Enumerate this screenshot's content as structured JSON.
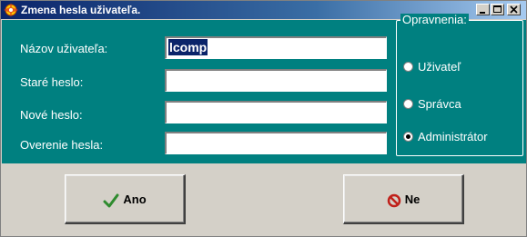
{
  "window": {
    "title": "Zmena hesla uživateľa.",
    "controls": {
      "minimize_icon": "minimize-icon",
      "maximize_icon": "maximize-icon",
      "close_icon": "close-icon"
    }
  },
  "form": {
    "fields": [
      {
        "label": "Názov uživateľa:",
        "value": "lcomp",
        "selected": true
      },
      {
        "label": "Staré heslo:",
        "value": ""
      },
      {
        "label": "Nové heslo:",
        "value": ""
      },
      {
        "label": "Overenie hesla:",
        "value": ""
      }
    ]
  },
  "permissions": {
    "title": "Opravnenia:",
    "options": [
      {
        "label": "Uživateľ",
        "checked": false
      },
      {
        "label": "Správca",
        "checked": false
      },
      {
        "label": "Administrátor",
        "checked": true
      }
    ]
  },
  "buttons": {
    "ok": {
      "label": "Ano",
      "icon": "checkmark-icon",
      "icon_color": "#2e8b2e"
    },
    "cancel": {
      "label": "Ne",
      "icon": "no-entry-icon",
      "icon_color": "#c0201a"
    }
  },
  "colors": {
    "panel": "#008080",
    "titlebar": "#0a246a",
    "face": "#d4d0c8"
  }
}
